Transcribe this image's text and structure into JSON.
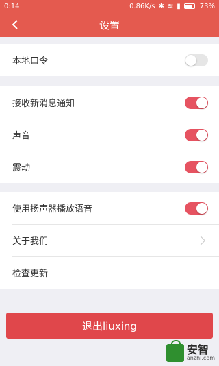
{
  "status_bar": {
    "time": "0:14",
    "net_speed": "0.86K/s",
    "battery": "73%"
  },
  "header": {
    "title": "设置",
    "back_icon": "chevron-left-icon"
  },
  "groups": [
    {
      "items": [
        {
          "label": "本地口令",
          "type": "toggle",
          "on": false
        }
      ]
    },
    {
      "items": [
        {
          "label": "接收新消息通知",
          "type": "toggle",
          "on": true
        },
        {
          "label": "声音",
          "type": "toggle",
          "on": true
        },
        {
          "label": "震动",
          "type": "toggle",
          "on": true
        }
      ]
    },
    {
      "items": [
        {
          "label": "使用扬声器播放语音",
          "type": "toggle",
          "on": true
        },
        {
          "label": "关于我们",
          "type": "link"
        },
        {
          "label": "检查更新",
          "type": "plain"
        }
      ]
    }
  ],
  "logout_button": {
    "label": "退出liuxing"
  },
  "watermark": {
    "text": "安智",
    "sub": "anzhi.com"
  },
  "colors": {
    "brand": "#e45a4f",
    "toggle_on": "#e65361",
    "toggle_off": "#e6e6e6",
    "logout": "#e0474b",
    "background": "#efeff4"
  }
}
